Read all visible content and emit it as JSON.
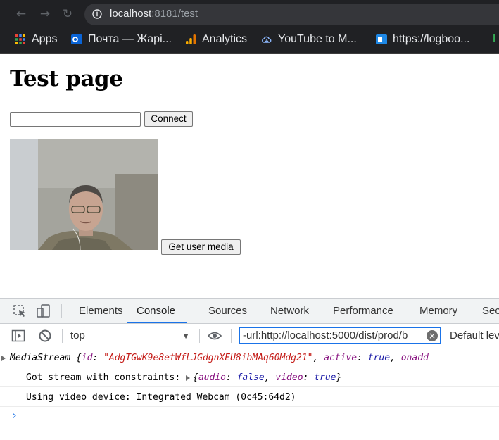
{
  "browser": {
    "url_host": "localhost",
    "url_rest": ":8181/test"
  },
  "bookmarks": [
    {
      "label": "Apps"
    },
    {
      "label": "Почта — Жарі..."
    },
    {
      "label": "Analytics"
    },
    {
      "label": "YouTube to M..."
    },
    {
      "label": "https://logboo..."
    },
    {
      "label": "I"
    }
  ],
  "page": {
    "title": "Test page",
    "connect_label": "Connect",
    "get_user_media_label": "Get user media",
    "input_value": ""
  },
  "devtools": {
    "tabs": [
      "Elements",
      "Console",
      "Sources",
      "Network",
      "Performance",
      "Memory",
      "Sec"
    ],
    "active_tab": "Console",
    "context": "top",
    "filter": "-url:http://localhost:5000/dist/prod/b",
    "levels": "Default lev"
  },
  "console": {
    "line1": {
      "prefix": "MediaStream {",
      "id_key": "id",
      "id_val": "\"AdgTGwK9e8etWfLJGdgnXEU8ibMAq60Mdg21\"",
      "active_key": "active",
      "active_val": "true",
      "more": "onadd"
    },
    "line2": {
      "text": "Got stream with constraints: ",
      "audio_key": "audio",
      "audio_val": "false",
      "video_key": "video",
      "video_val": "true"
    },
    "line3": {
      "text": "Using video device: Integrated Webcam (0c45:64d2)"
    }
  },
  "colors": {
    "chrome_dark": "#202124",
    "accent": "#1a73e8",
    "string": "#c41a16",
    "keyword": "#1a1aa6"
  }
}
